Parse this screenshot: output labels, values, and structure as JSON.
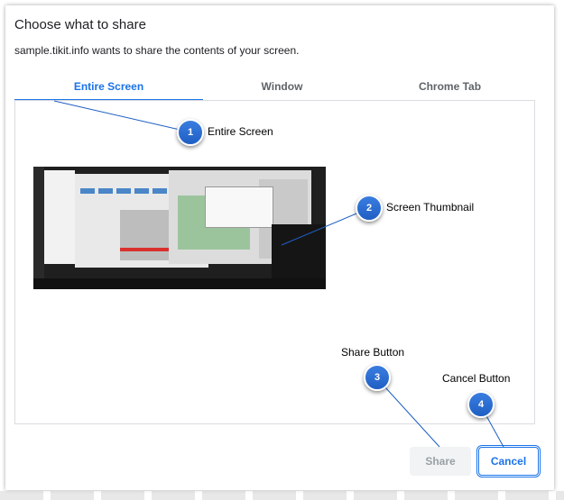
{
  "dialog": {
    "title": "Choose what to share",
    "subtitle": "sample.tikit.info wants to share the contents of your screen."
  },
  "tabs": [
    {
      "label": "Entire Screen",
      "active": true
    },
    {
      "label": "Window",
      "active": false
    },
    {
      "label": "Chrome Tab",
      "active": false
    }
  ],
  "buttons": {
    "share_label": "Share",
    "cancel_label": "Cancel"
  },
  "callouts": [
    {
      "number": "1",
      "label": "Entire Screen"
    },
    {
      "number": "2",
      "label": "Screen Thumbnail"
    },
    {
      "number": "3",
      "label": "Share Button"
    },
    {
      "number": "4",
      "label": "Cancel Button"
    }
  ],
  "colors": {
    "accent": "#1a73e8",
    "callout": "#2a6fd6",
    "disabled_text": "#9aa0a6"
  }
}
